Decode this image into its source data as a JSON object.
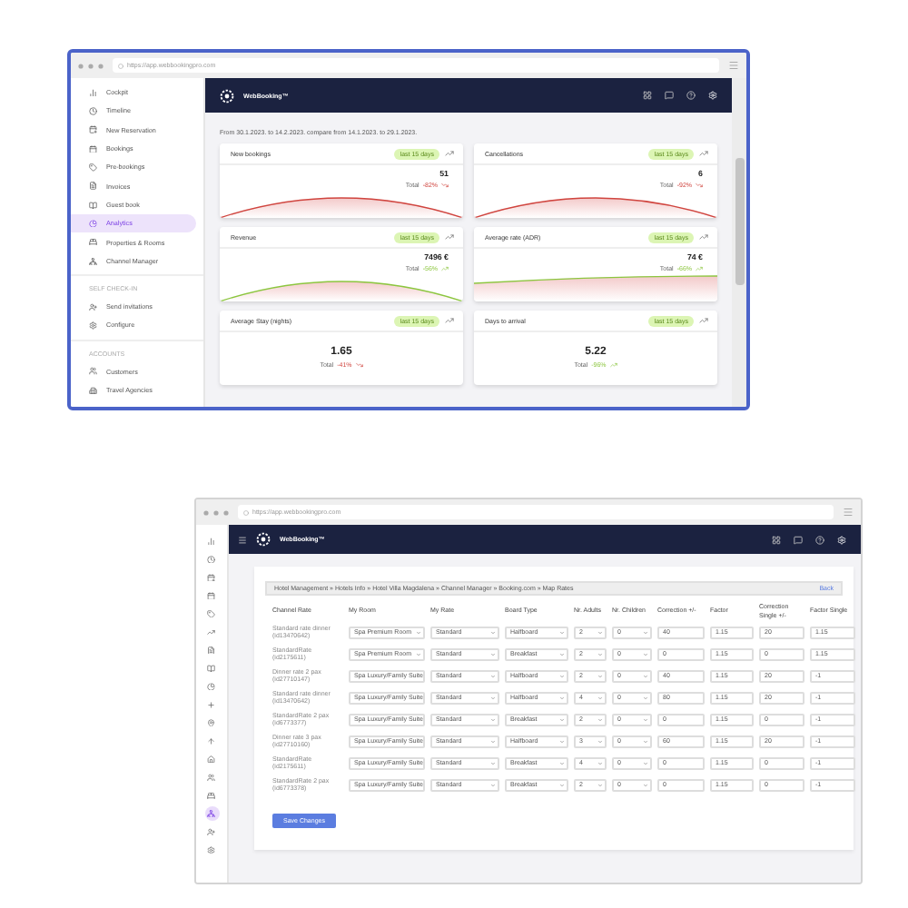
{
  "top": {
    "url": "https://app.webbookingpro.com",
    "logo": "WebBooking™",
    "sidebar": {
      "sections": [
        {
          "items": [
            {
              "label": "Cockpit",
              "selected": false
            },
            {
              "label": "Timeline",
              "selected": false
            },
            {
              "label": "New Reservation",
              "selected": false
            },
            {
              "label": "Bookings",
              "selected": false
            },
            {
              "label": "Pre-bookings",
              "selected": false
            },
            {
              "label": "Invoices",
              "selected": false
            },
            {
              "label": "Guest book",
              "selected": false
            },
            {
              "label": "Analytics",
              "selected": true
            },
            {
              "label": "Properties & Rooms",
              "selected": false
            },
            {
              "label": "Channel Manager",
              "selected": false
            }
          ]
        },
        {
          "heading": "SELF CHECK-IN",
          "items": [
            {
              "label": "Send invitations",
              "selected": false
            },
            {
              "label": "Configure",
              "selected": false
            }
          ]
        },
        {
          "heading": "ACCOUNTS",
          "items": [
            {
              "label": "Customers",
              "selected": false
            },
            {
              "label": "Travel Agencies",
              "selected": false
            }
          ]
        }
      ]
    },
    "date_range": "From 30.1.2023. to 14.2.2023. compare from 14.1.2023. to 29.1.2023.",
    "cards": [
      {
        "title": "New bookings",
        "badge": "last 15 days",
        "value": "51",
        "total_label": "Total",
        "change": "-82%",
        "falling": true,
        "kind": "arc"
      },
      {
        "title": "Cancellations",
        "badge": "last 15 days",
        "value": "6",
        "total_label": "Total",
        "change": "-92%",
        "falling": true,
        "kind": "arc"
      },
      {
        "title": "Revenue",
        "badge": "last 15 days",
        "value": "7496 €",
        "total_label": "Total",
        "change": "-56%",
        "falling": false,
        "kind": "arc"
      },
      {
        "title": "Average rate (ADR)",
        "badge": "last 15 days",
        "value": "74 €",
        "total_label": "Total",
        "change": "-66%",
        "falling": false,
        "kind": "flat"
      },
      {
        "title": "Average Stay (nights)",
        "badge": "last 15 days",
        "value": "1.65",
        "total_label": "Total",
        "change": "-41%",
        "falling": true,
        "kind": "plain"
      },
      {
        "title": "Days to arrival",
        "badge": "last 15 days",
        "value": "5.22",
        "total_label": "Total",
        "change": "-96%",
        "falling": false,
        "kind": "plain"
      }
    ]
  },
  "bottom": {
    "url": "https://app.webbookingpro.com",
    "logo": "WebBooking™",
    "rail": [
      {
        "selected": false
      },
      {
        "selected": false
      },
      {
        "selected": false
      },
      {
        "selected": false
      },
      {
        "selected": false
      },
      {
        "selected": false
      },
      {
        "selected": false
      },
      {
        "selected": false
      },
      {
        "selected": false
      },
      {
        "selected": false
      },
      {
        "selected": false
      },
      {
        "selected": false
      },
      {
        "selected": false
      },
      {
        "selected": false
      },
      {
        "selected": false
      },
      {
        "selected": true
      },
      {
        "selected": false
      },
      {
        "selected": false
      }
    ],
    "breadcrumb": "Hotel Management » Hotels Info » Hotel Villa Magdalena » Channel Manager » Booking.com » Map Rates",
    "back": "Back",
    "columns": [
      "Channel Rate",
      "My Room",
      "My Rate",
      "Board Type",
      "Nr. Adults",
      "Nr. Children",
      "Correction +/-",
      "Factor",
      "Correction Single +/-",
      "Factor Single"
    ],
    "rows": [
      {
        "channel_rate": "Standard rate dinner (id13470642)",
        "my_room": "Spa Premium Room",
        "my_rate": "Standard",
        "board_type": "Halfboard",
        "adults": "2",
        "children": "0",
        "correction": "40",
        "factor": "1.15",
        "correction_single": "20",
        "factor_single": "1.15"
      },
      {
        "channel_rate": "StandardRate (id2175611)",
        "my_room": "Spa Premium Room",
        "my_rate": "Standard",
        "board_type": "Breakfast",
        "adults": "2",
        "children": "0",
        "correction": "0",
        "factor": "1.15",
        "correction_single": "0",
        "factor_single": "1.15"
      },
      {
        "channel_rate": "Dinner rate 2 pax (id27710147)",
        "my_room": "Spa Luxury/Family Suite",
        "my_rate": "Standard",
        "board_type": "Halfboard",
        "adults": "2",
        "children": "0",
        "correction": "40",
        "factor": "1.15",
        "correction_single": "20",
        "factor_single": "-1"
      },
      {
        "channel_rate": "Standard rate dinner (id13470642)",
        "my_room": "Spa Luxury/Family Suite",
        "my_rate": "Standard",
        "board_type": "Halfboard",
        "adults": "4",
        "children": "0",
        "correction": "80",
        "factor": "1.15",
        "correction_single": "20",
        "factor_single": "-1"
      },
      {
        "channel_rate": "StandardRate 2 pax (id6773377)",
        "my_room": "Spa Luxury/Family Suite",
        "my_rate": "Standard",
        "board_type": "Breakfast",
        "adults": "2",
        "children": "0",
        "correction": "0",
        "factor": "1.15",
        "correction_single": "0",
        "factor_single": "-1"
      },
      {
        "channel_rate": "Dinner rate 3 pax (id27710160)",
        "my_room": "Spa Luxury/Family Suite",
        "my_rate": "Standard",
        "board_type": "Halfboard",
        "adults": "3",
        "children": "0",
        "correction": "60",
        "factor": "1.15",
        "correction_single": "20",
        "factor_single": "-1"
      },
      {
        "channel_rate": "StandardRate (id2175611)",
        "my_room": "Spa Luxury/Family Suite",
        "my_rate": "Standard",
        "board_type": "Breakfast",
        "adults": "4",
        "children": "0",
        "correction": "0",
        "factor": "1.15",
        "correction_single": "0",
        "factor_single": "-1"
      },
      {
        "channel_rate": "StandardRate 2 pax (id6773378)",
        "my_room": "Spa Luxury/Family Suite",
        "my_rate": "Standard",
        "board_type": "Breakfast",
        "adults": "2",
        "children": "0",
        "correction": "0",
        "factor": "1.15",
        "correction_single": "0",
        "factor_single": "-1"
      }
    ],
    "save_button": "Save Changes"
  }
}
